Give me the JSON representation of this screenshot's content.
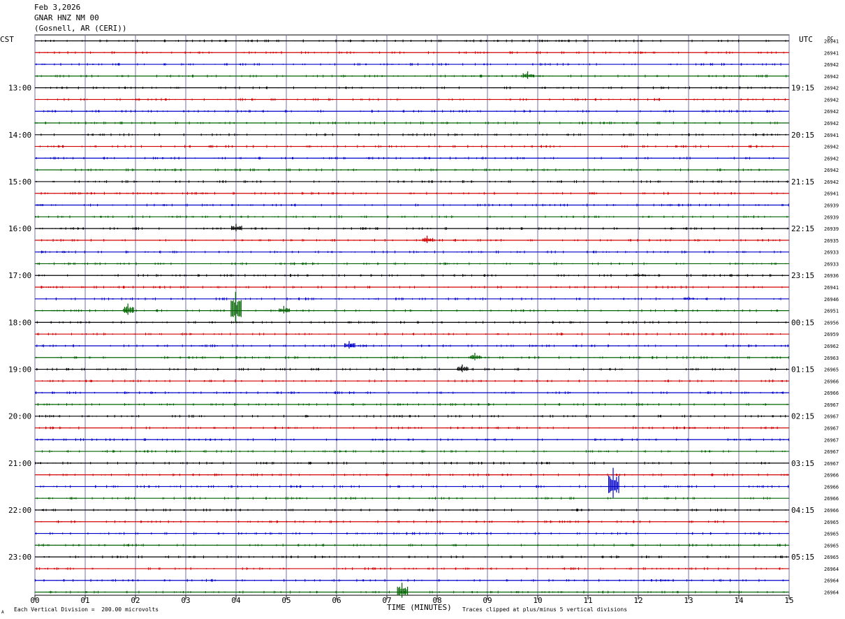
{
  "header": {
    "date": "Feb 3,2026",
    "channel": "GNAR HNZ NM 00",
    "location": "(Gosnell, AR (CERI))"
  },
  "left_tz": "CST",
  "right_tz": "UTC",
  "dc_label": "DC",
  "footer": {
    "scale_note": "Each Vertical Division =  200.00 microvolts",
    "clip_note": "Traces clipped at plus/minus 5 vertical divisions",
    "corner_mark": "A"
  },
  "colors": {
    "cycle": [
      "#000000",
      "#d40000",
      "#0000cc",
      "#006400"
    ],
    "grid": "#7070a0"
  },
  "chart_data": {
    "type": "line",
    "xlabel": "TIME (MINUTES)",
    "xlim": [
      0,
      15
    ],
    "x_ticks": [
      "00",
      "01",
      "02",
      "03",
      "04",
      "05",
      "06",
      "07",
      "08",
      "09",
      "10",
      "11",
      "12",
      "13",
      "14",
      "15"
    ],
    "trace_count": 48,
    "left_hour_labels": [
      "13:00",
      "14:00",
      "15:00",
      "16:00",
      "17:00",
      "18:00",
      "19:00",
      "20:00",
      "21:00",
      "22:00",
      "23:00"
    ],
    "right_hour_labels": [
      "19:15",
      "20:15",
      "21:15",
      "22:15",
      "23:15",
      "00:15",
      "01:15",
      "02:15",
      "03:15",
      "04:15",
      "05:15"
    ],
    "dc_offsets": [
      "26941",
      "26941",
      "26942",
      "26942",
      "26942",
      "26942",
      "26942",
      "26942",
      "26941",
      "26942",
      "26942",
      "26942",
      "26942",
      "26941",
      "26939",
      "26939",
      "26939",
      "26935",
      "26933",
      "26933",
      "26936",
      "26941",
      "26946",
      "26951",
      "26956",
      "26959",
      "26962",
      "26963",
      "26965",
      "26966",
      "26966",
      "26967",
      "26967",
      "26967",
      "26967",
      "26967",
      "26967",
      "26966",
      "26966",
      "26966",
      "26966",
      "26965",
      "26965",
      "26965",
      "26965",
      "26964",
      "26964",
      "26964"
    ],
    "events": [
      {
        "trace": 3,
        "minute": 9.8,
        "amp": 2
      },
      {
        "trace": 16,
        "minute": 4.0,
        "amp": 2
      },
      {
        "trace": 17,
        "minute": 7.8,
        "amp": 2
      },
      {
        "trace": 20,
        "minute": 12.0,
        "amp": 1
      },
      {
        "trace": 22,
        "minute": 13.0,
        "amp": 1
      },
      {
        "trace": 23,
        "minute": 3.99,
        "amp": 8
      },
      {
        "trace": 23,
        "minute": 1.85,
        "amp": 3
      },
      {
        "trace": 23,
        "minute": 4.95,
        "amp": 2
      },
      {
        "trace": 26,
        "minute": 6.25,
        "amp": 2
      },
      {
        "trace": 27,
        "minute": 8.75,
        "amp": 2
      },
      {
        "trace": 28,
        "minute": 8.5,
        "amp": 2
      },
      {
        "trace": 38,
        "minute": 11.5,
        "amp": 8
      },
      {
        "trace": 47,
        "minute": 7.3,
        "amp": 4
      }
    ]
  }
}
